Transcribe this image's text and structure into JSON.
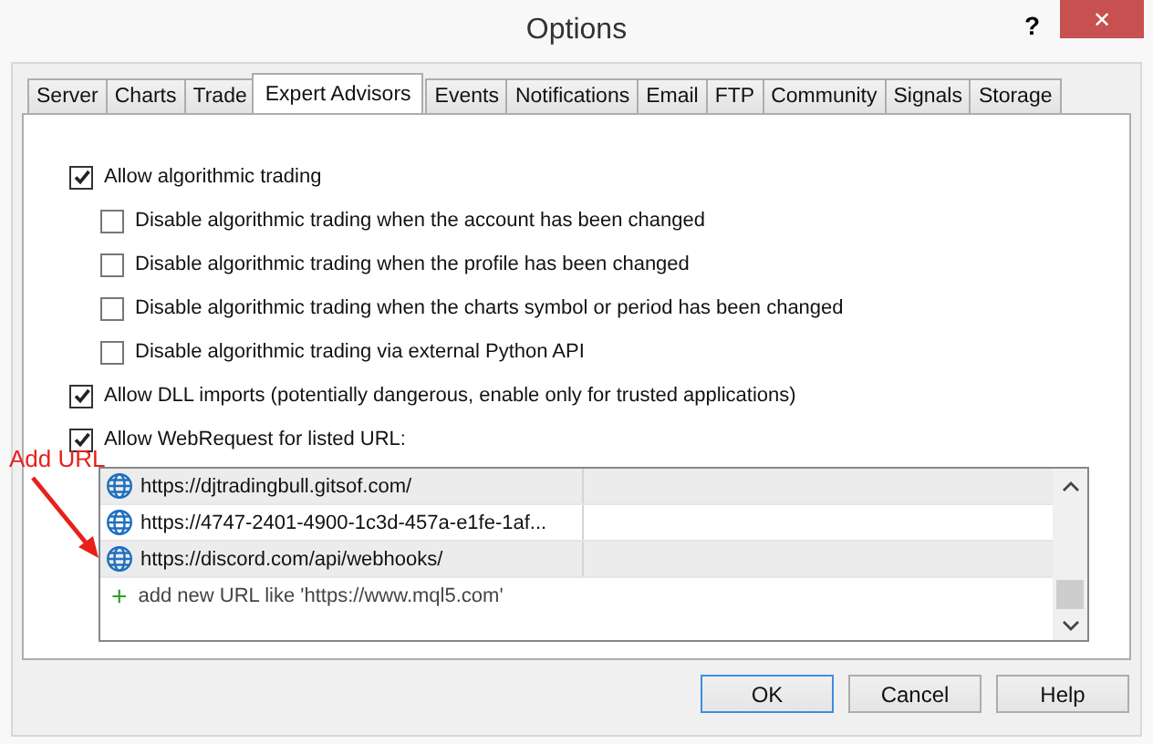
{
  "window": {
    "title": "Options",
    "help": "?",
    "close": "✕"
  },
  "tabs": [
    {
      "label": "Server",
      "selected": false
    },
    {
      "label": "Charts",
      "selected": false
    },
    {
      "label": "Trade",
      "selected": false
    },
    {
      "label": "Expert Advisors",
      "selected": true
    },
    {
      "label": "Events",
      "selected": false
    },
    {
      "label": "Notifications",
      "selected": false
    },
    {
      "label": "Email",
      "selected": false
    },
    {
      "label": "FTP",
      "selected": false
    },
    {
      "label": "Community",
      "selected": false
    },
    {
      "label": "Signals",
      "selected": false
    },
    {
      "label": "Storage",
      "selected": false
    }
  ],
  "options": [
    {
      "label": "Allow algorithmic trading",
      "checked": true,
      "children": [
        {
          "label": "Disable algorithmic trading when the account has been changed",
          "checked": false
        },
        {
          "label": "Disable algorithmic trading when the profile has been changed",
          "checked": false
        },
        {
          "label": "Disable algorithmic trading when the charts symbol or period has been changed",
          "checked": false
        },
        {
          "label": "Disable algorithmic trading via external Python API",
          "checked": false
        }
      ]
    },
    {
      "label": "Allow DLL imports (potentially dangerous, enable only for trusted applications)",
      "checked": true
    },
    {
      "label": "Allow WebRequest for listed URL:",
      "checked": true
    }
  ],
  "urls": [
    {
      "url": "https://djtradingbull.gitsof.com/"
    },
    {
      "url": "https://4747-2401-4900-1c3d-457a-e1fe-1af..."
    },
    {
      "url": "https://discord.com/api/webhooks/"
    }
  ],
  "add_row": {
    "icon": "+",
    "text": "add new URL like 'https://www.mql5.com'"
  },
  "annotation": {
    "text": "Add URL"
  },
  "buttons": [
    {
      "label": "OK",
      "default": true
    },
    {
      "label": "Cancel",
      "default": false
    },
    {
      "label": "Help",
      "default": false
    }
  ]
}
